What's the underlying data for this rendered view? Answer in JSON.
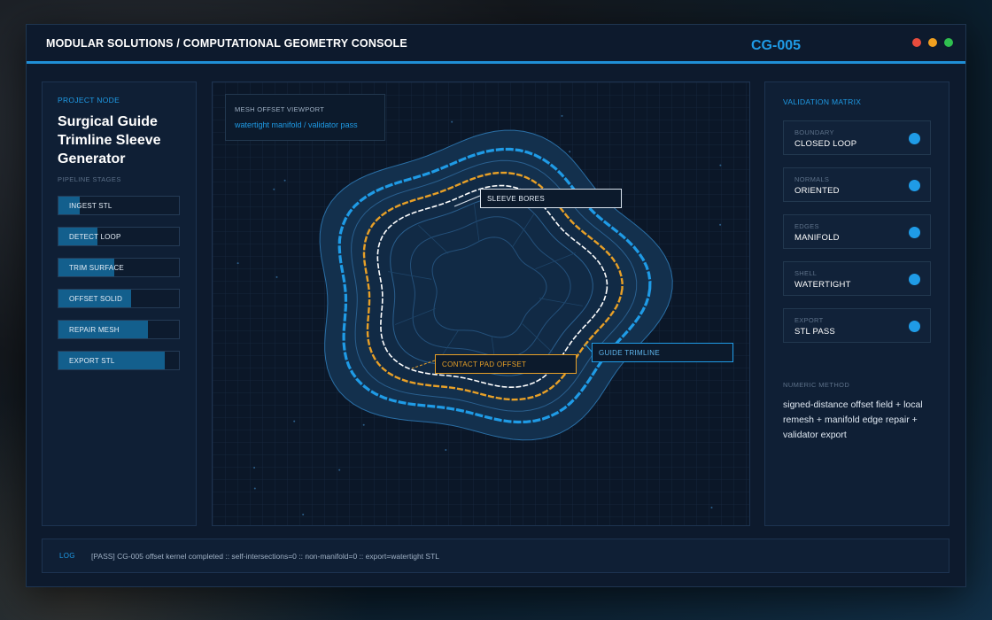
{
  "header": {
    "title": "MODULAR SOLUTIONS / COMPUTATIONAL GEOMETRY CONSOLE",
    "console_id": "CG-005",
    "window_controls": [
      "close",
      "minimize",
      "maximize"
    ]
  },
  "left_panel": {
    "section_label": "PROJECT NODE",
    "project_title": "Surgical Guide Trimline Sleeve Generator",
    "pipeline_label": "PIPELINE STAGES",
    "stages": [
      {
        "label": "INGEST STL",
        "progress": 0.18
      },
      {
        "label": "DETECT LOOP",
        "progress": 0.32
      },
      {
        "label": "TRIM SURFACE",
        "progress": 0.46
      },
      {
        "label": "OFFSET SOLID",
        "progress": 0.6
      },
      {
        "label": "REPAIR MESH",
        "progress": 0.74
      },
      {
        "label": "EXPORT STL",
        "progress": 0.88
      }
    ]
  },
  "viewport": {
    "card_label": "MESH OFFSET VIEWPORT",
    "card_subtitle": "watertight manifold / validator pass",
    "callouts": {
      "sleeve": "SLEEVE BORES",
      "contact": "CONTACT PAD OFFSET",
      "trimline": "GUIDE TRIMLINE"
    }
  },
  "right_panel": {
    "section_label": "VALIDATION MATRIX",
    "items": [
      {
        "key": "BOUNDARY",
        "value": "CLOSED LOOP"
      },
      {
        "key": "NORMALS",
        "value": "ORIENTED"
      },
      {
        "key": "EDGES",
        "value": "MANIFOLD"
      },
      {
        "key": "SHELL",
        "value": "WATERTIGHT"
      },
      {
        "key": "EXPORT",
        "value": "STL PASS"
      }
    ],
    "numeric_label": "NUMERIC METHOD",
    "numeric_text": "signed-distance offset field + local remesh + manifold edge repair + validator export"
  },
  "log": {
    "label": "LOG",
    "text": "[PASS] CG-005 offset kernel completed :: self-intersections=0 :: non-manifold=0 :: export=watertight STL"
  },
  "colors": {
    "accent": "#1f9be6",
    "warning": "#e8a027",
    "window_red": "#e84c3d",
    "window_orange": "#f0a020",
    "window_green": "#2fbf4f"
  }
}
